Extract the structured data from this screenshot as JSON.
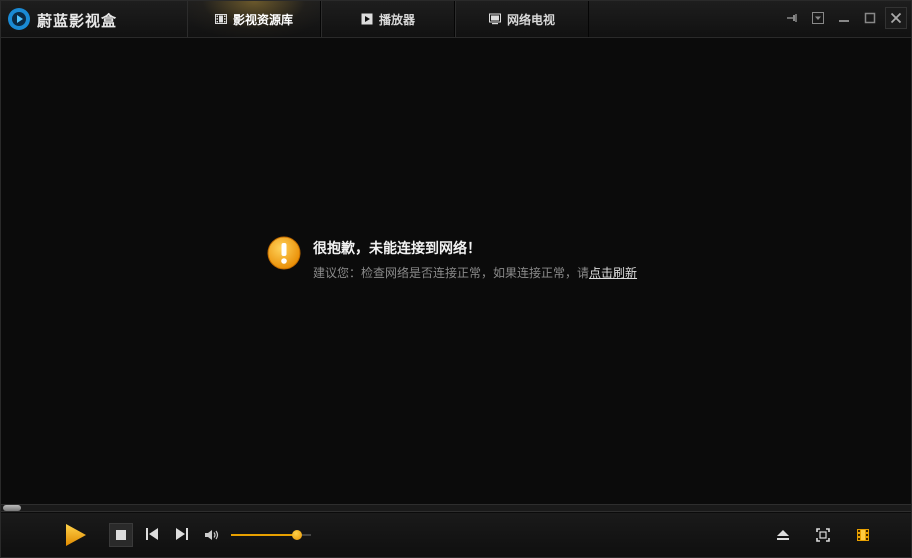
{
  "app": {
    "title": "蔚蓝影视盒"
  },
  "tabs": [
    {
      "label": "影视资源库",
      "icon": "film-icon",
      "active": true
    },
    {
      "label": "播放器",
      "icon": "play-square-icon",
      "active": false
    },
    {
      "label": "网络电视",
      "icon": "tv-icon",
      "active": false
    }
  ],
  "window_controls": [
    "pin-icon",
    "menu-dropdown-icon",
    "minimize-icon",
    "maximize-icon",
    "close-icon"
  ],
  "message": {
    "title": "很抱歉，未能连接到网络！",
    "text": "建议您：检查网络是否连接正常，如果连接正常，请",
    "link": "点击刷新"
  },
  "player": {
    "progress": 0.0,
    "volume": 0.82
  },
  "colors": {
    "accent": "#e8a000",
    "background": "#0b0b0b",
    "warning": "#f5a623"
  }
}
